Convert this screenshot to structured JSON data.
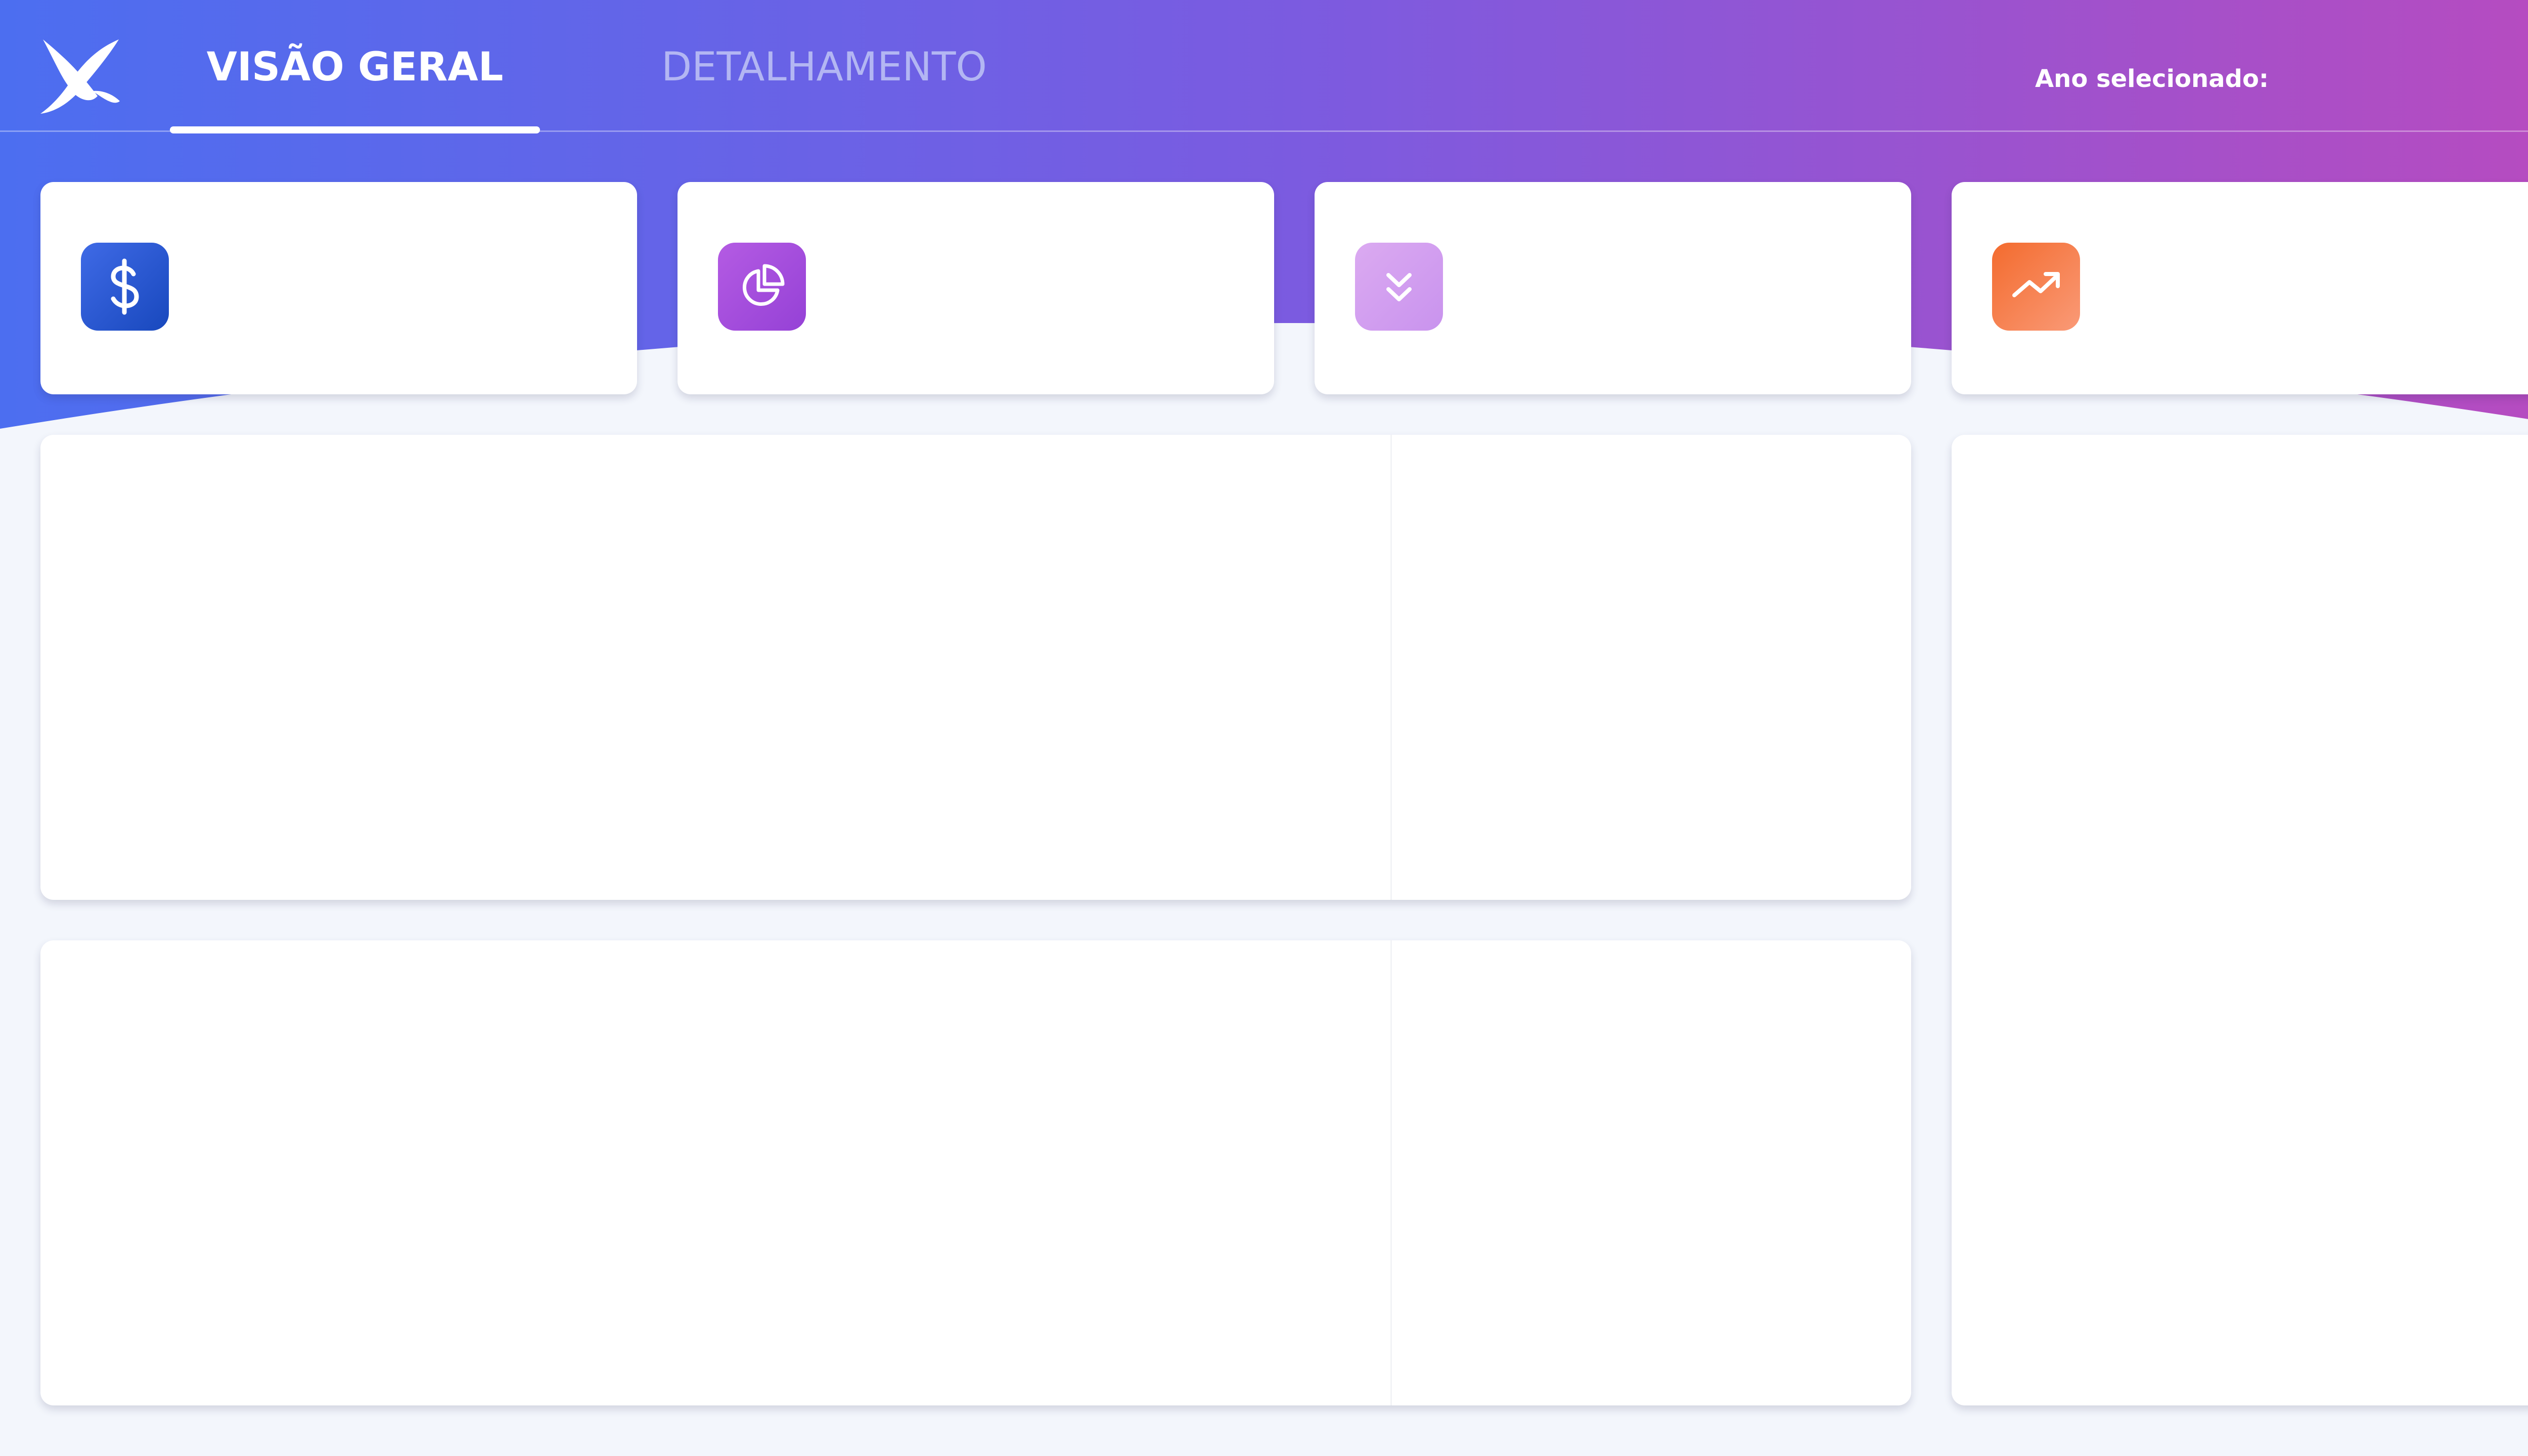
{
  "nav": {
    "tabs": [
      {
        "label": "VISÃO GERAL",
        "active": true
      },
      {
        "label": "DETALHAMENTO",
        "active": false
      }
    ],
    "year_filter_label": "Ano selecionado:"
  },
  "kpi_icons": [
    "dollar-icon",
    "pie-chart-icon",
    "chevrons-down-icon",
    "trending-up-icon"
  ],
  "colors": {
    "header_gradient_start": "#4c6ef0",
    "header_gradient_mid": "#7b5be0",
    "header_gradient_end": "#b84bbf",
    "page_background": "#f3f6fc",
    "card_background": "#ffffff",
    "kpi_icon_dollar": "#2a5ad6",
    "kpi_icon_pie": "#a64edd",
    "kpi_icon_chevrons": "#d29ff0",
    "kpi_icon_trend": "#f47a47"
  }
}
